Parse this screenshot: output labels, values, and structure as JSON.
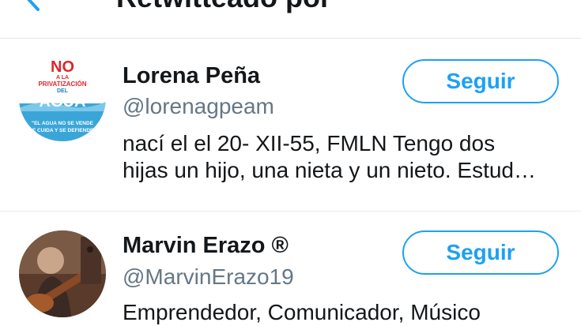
{
  "header": {
    "title": "Retwitteado por",
    "back_icon": "arrow-left-icon"
  },
  "users": [
    {
      "name": "Lorena Peña",
      "handle": "@lorenagpeam",
      "bio_lines": [
        "nací el el 20- XII-55, FMLN Tengo dos",
        "hijas un hijo, una nieta y un nieto. Estud…"
      ],
      "follow_label": "Seguir",
      "avatar": {
        "badge_no": "NO",
        "badge_line1": "A LA",
        "badge_line2": "PRIVATIZACIÓN",
        "badge_line3": "DEL",
        "badge_main": "AGUA",
        "badge_footer1": "\"EL AGUA NO SE VENDE",
        "badge_footer2": "SE CUIDA Y SE DEFIENDE\""
      }
    },
    {
      "name": "Marvin Erazo ®",
      "handle": "@MarvinErazo19",
      "bio_lines": [
        "Emprendedor, Comunicador, Músico"
      ],
      "follow_label": "Seguir"
    }
  ],
  "colors": {
    "accent": "#1da1f2",
    "text": "#14171a",
    "secondary_text": "#657786"
  }
}
